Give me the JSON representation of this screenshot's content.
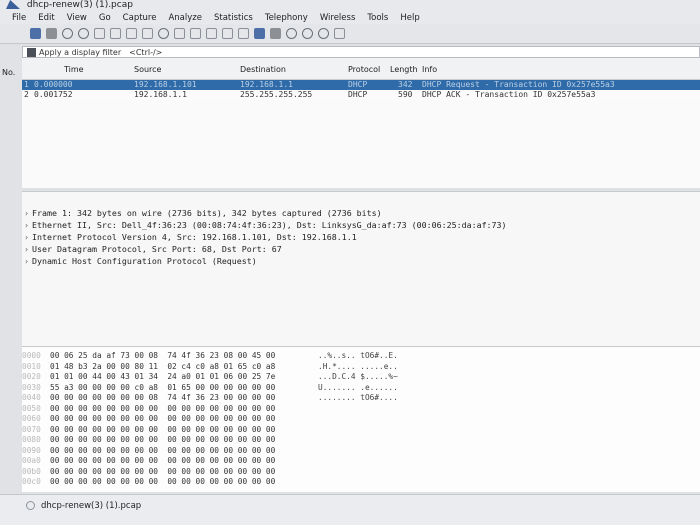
{
  "window": {
    "title": "dhcp-renew(3) (1).pcap"
  },
  "menu": [
    "File",
    "Edit",
    "View",
    "Go",
    "Capture",
    "Analyze",
    "Statistics",
    "Telephony",
    "Wireless",
    "Tools",
    "Help"
  ],
  "filter": {
    "placeholder": "Apply a display filter",
    "shortcut": "<Ctrl-/>"
  },
  "packet_list": {
    "columns": {
      "no": "No.",
      "time": "Time",
      "source": "Source",
      "destination": "Destination",
      "protocol": "Protocol",
      "length": "Length",
      "info": "Info"
    },
    "rows": [
      {
        "no": "1",
        "time": "0.000000",
        "source": "192.168.1.101",
        "destination": "192.168.1.1",
        "protocol": "DHCP",
        "length": "342",
        "info": "DHCP Request  - Transaction ID 0x257e55a3",
        "selected": true
      },
      {
        "no": "2",
        "time": "0.001752",
        "source": "192.168.1.1",
        "destination": "255.255.255.255",
        "protocol": "DHCP",
        "length": "590",
        "info": "DHCP ACK      - Transaction ID 0x257e55a3",
        "selected": false
      }
    ]
  },
  "details": [
    "Frame 1: 342 bytes on wire (2736 bits), 342 bytes captured (2736 bits)",
    "Ethernet II, Src: Dell_4f:36:23 (00:08:74:4f:36:23), Dst: LinksysG_da:af:73 (00:06:25:da:af:73)",
    "Internet Protocol Version 4, Src: 192.168.1.101, Dst: 192.168.1.1",
    "User Datagram Protocol, Src Port: 68, Dst Port: 67",
    "Dynamic Host Configuration Protocol (Request)"
  ],
  "bytes": [
    {
      "off": "0000",
      "hex": "00 06 25 da af 73 00 08  74 4f 36 23 08 00 45 00",
      "ascii": "..%..s.. tO6#..E."
    },
    {
      "off": "0010",
      "hex": "01 48 b3 2a 00 00 80 11  02 c4 c0 a8 01 65 c0 a8",
      "ascii": ".H.*.... .....e.."
    },
    {
      "off": "0020",
      "hex": "01 01 00 44 00 43 01 34  24 a0 01 01 06 00 25 7e",
      "ascii": "...D.C.4 $.....%~"
    },
    {
      "off": "0030",
      "hex": "55 a3 00 00 00 00 c0 a8  01 65 00 00 00 00 00 00",
      "ascii": "U....... .e......"
    },
    {
      "off": "0040",
      "hex": "00 00 00 00 00 00 00 08  74 4f 36 23 00 00 00 00",
      "ascii": "........ tO6#...."
    },
    {
      "off": "0050",
      "hex": "00 00 00 00 00 00 00 00  00 00 00 00 00 00 00 00",
      "ascii": ""
    },
    {
      "off": "0060",
      "hex": "00 00 00 00 00 00 00 00  00 00 00 00 00 00 00 00",
      "ascii": ""
    },
    {
      "off": "0070",
      "hex": "00 00 00 00 00 00 00 00  00 00 00 00 00 00 00 00",
      "ascii": ""
    },
    {
      "off": "0080",
      "hex": "00 00 00 00 00 00 00 00  00 00 00 00 00 00 00 00",
      "ascii": ""
    },
    {
      "off": "0090",
      "hex": "00 00 00 00 00 00 00 00  00 00 00 00 00 00 00 00",
      "ascii": ""
    },
    {
      "off": "00a0",
      "hex": "00 00 00 00 00 00 00 00  00 00 00 00 00 00 00 00",
      "ascii": ""
    },
    {
      "off": "00b0",
      "hex": "00 00 00 00 00 00 00 00  00 00 00 00 00 00 00 00",
      "ascii": ""
    },
    {
      "off": "00c0",
      "hex": "00 00 00 00 00 00 00 00  00 00 00 00 00 00 00 00",
      "ascii": ""
    }
  ],
  "status": {
    "file": "dhcp-renew(3) (1).pcap"
  },
  "colors": {
    "selected_row": "#2f6ba8",
    "accent": "#4d6fa8"
  }
}
